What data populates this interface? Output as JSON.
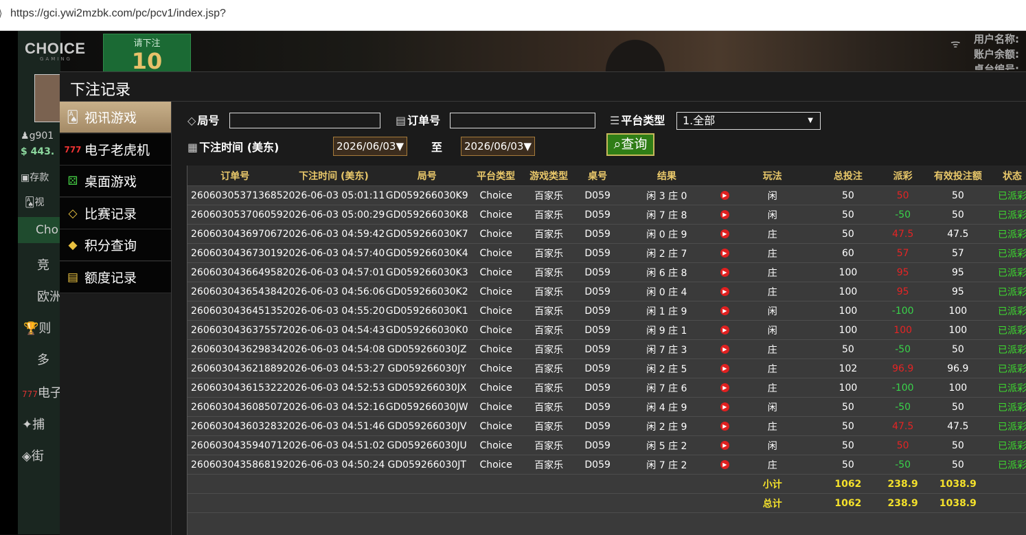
{
  "browser": {
    "url": "https://gci.ywi2mzbk.com/pc/pcv1/index.jsp?"
  },
  "game": {
    "logo": "CHOICE",
    "logo_sub": "GAMING",
    "bet_prompt": "请下注",
    "bet_countdown": "10",
    "right_info": [
      "用户名称:",
      "账户余额:",
      "桌台编号:"
    ],
    "left_fragments": {
      "user": "g901",
      "balance": "443.",
      "deposit": "存款",
      "video": "视",
      "choice": "Cho",
      "jing": "竞",
      "ou": "欧洲",
      "bai": "则",
      "duo": "多",
      "dian": "电子",
      "bu": "捕",
      "jie": "街"
    }
  },
  "modal": {
    "title": "下注记录",
    "sidebar": [
      {
        "label": "视讯游戏",
        "icon": "cards-icon",
        "active": true
      },
      {
        "label": "电子老虎机",
        "icon": "slot-777-icon",
        "active": false
      },
      {
        "label": "桌面游戏",
        "icon": "dice-icon",
        "active": false
      },
      {
        "label": "比赛记录",
        "icon": "ticket-icon",
        "active": false
      },
      {
        "label": "积分查询",
        "icon": "diamond-icon",
        "active": false
      },
      {
        "label": "额度记录",
        "icon": "document-icon",
        "active": false
      }
    ],
    "filters": {
      "round_label": "局号",
      "order_label": "订单号",
      "platform_label": "平台类型",
      "platform_value": "1.全部",
      "time_label": "下注时间 (美东)",
      "date_from": "2026/06/03▼",
      "to_label": "至",
      "date_to": "2026/06/03▼",
      "query_label": "查询"
    },
    "table": {
      "headers": [
        "订单号",
        "下注时间 (美东)",
        "局号",
        "平台类型",
        "游戏类型",
        "桌号",
        "结果",
        "",
        "玩法",
        "总投注",
        "派彩",
        "有效投注额",
        "状态"
      ],
      "rows": [
        [
          "260603053713685",
          "2026-06-03 05:01:11",
          "GD059266030K9",
          "Choice",
          "百家乐",
          "D059",
          "闲 3 庄 0",
          "闲",
          "50",
          "50",
          "50",
          "已派彩"
        ],
        [
          "260603053706059",
          "2026-06-03 05:00:29",
          "GD059266030K8",
          "Choice",
          "百家乐",
          "D059",
          "闲 7 庄 8",
          "闲",
          "50",
          "-50",
          "50",
          "已派彩"
        ],
        [
          "260603043697067",
          "2026-06-03 04:59:42",
          "GD059266030K7",
          "Choice",
          "百家乐",
          "D059",
          "闲 0 庄 9",
          "庄",
          "50",
          "47.5",
          "47.5",
          "已派彩"
        ],
        [
          "260603043673019",
          "2026-06-03 04:57:40",
          "GD059266030K4",
          "Choice",
          "百家乐",
          "D059",
          "闲 2 庄 7",
          "庄",
          "60",
          "57",
          "57",
          "已派彩"
        ],
        [
          "260603043664958",
          "2026-06-03 04:57:01",
          "GD059266030K3",
          "Choice",
          "百家乐",
          "D059",
          "闲 6 庄 8",
          "庄",
          "100",
          "95",
          "95",
          "已派彩"
        ],
        [
          "260603043654384",
          "2026-06-03 04:56:06",
          "GD059266030K2",
          "Choice",
          "百家乐",
          "D059",
          "闲 0 庄 4",
          "庄",
          "100",
          "95",
          "95",
          "已派彩"
        ],
        [
          "260603043645135",
          "2026-06-03 04:55:20",
          "GD059266030K1",
          "Choice",
          "百家乐",
          "D059",
          "闲 1 庄 9",
          "闲",
          "100",
          "-100",
          "100",
          "已派彩"
        ],
        [
          "260603043637557",
          "2026-06-03 04:54:43",
          "GD059266030K0",
          "Choice",
          "百家乐",
          "D059",
          "闲 9 庄 1",
          "闲",
          "100",
          "100",
          "100",
          "已派彩"
        ],
        [
          "260603043629834",
          "2026-06-03 04:54:08",
          "GD059266030JZ",
          "Choice",
          "百家乐",
          "D059",
          "闲 7 庄 3",
          "庄",
          "50",
          "-50",
          "50",
          "已派彩"
        ],
        [
          "260603043621889",
          "2026-06-03 04:53:27",
          "GD059266030JY",
          "Choice",
          "百家乐",
          "D059",
          "闲 2 庄 5",
          "庄",
          "102",
          "96.9",
          "96.9",
          "已派彩"
        ],
        [
          "260603043615322",
          "2026-06-03 04:52:53",
          "GD059266030JX",
          "Choice",
          "百家乐",
          "D059",
          "闲 7 庄 6",
          "庄",
          "100",
          "-100",
          "100",
          "已派彩"
        ],
        [
          "260603043608507",
          "2026-06-03 04:52:16",
          "GD059266030JW",
          "Choice",
          "百家乐",
          "D059",
          "闲 4 庄 9",
          "闲",
          "50",
          "-50",
          "50",
          "已派彩"
        ],
        [
          "260603043603283",
          "2026-06-03 04:51:46",
          "GD059266030JV",
          "Choice",
          "百家乐",
          "D059",
          "闲 2 庄 9",
          "庄",
          "50",
          "47.5",
          "47.5",
          "已派彩"
        ],
        [
          "260603043594071",
          "2026-06-03 04:51:02",
          "GD059266030JU",
          "Choice",
          "百家乐",
          "D059",
          "闲 5 庄 2",
          "闲",
          "50",
          "50",
          "50",
          "已派彩"
        ],
        [
          "260603043586819",
          "2026-06-03 04:50:24",
          "GD059266030JT",
          "Choice",
          "百家乐",
          "D059",
          "闲 7 庄 2",
          "庄",
          "50",
          "-50",
          "50",
          "已派彩"
        ]
      ],
      "subtotal": {
        "label": "小计",
        "total_bet": "1062",
        "payout": "238.9",
        "valid_bet": "1038.9"
      },
      "total": {
        "label": "总计",
        "total_bet": "1062",
        "payout": "238.9",
        "valid_bet": "1038.9"
      }
    },
    "colors": {
      "positive_payout": "#e52424",
      "negative_payout": "#39d34a",
      "status": "#3ddc2f",
      "header": "#e9c86a",
      "sum": "#f4e12b"
    }
  }
}
